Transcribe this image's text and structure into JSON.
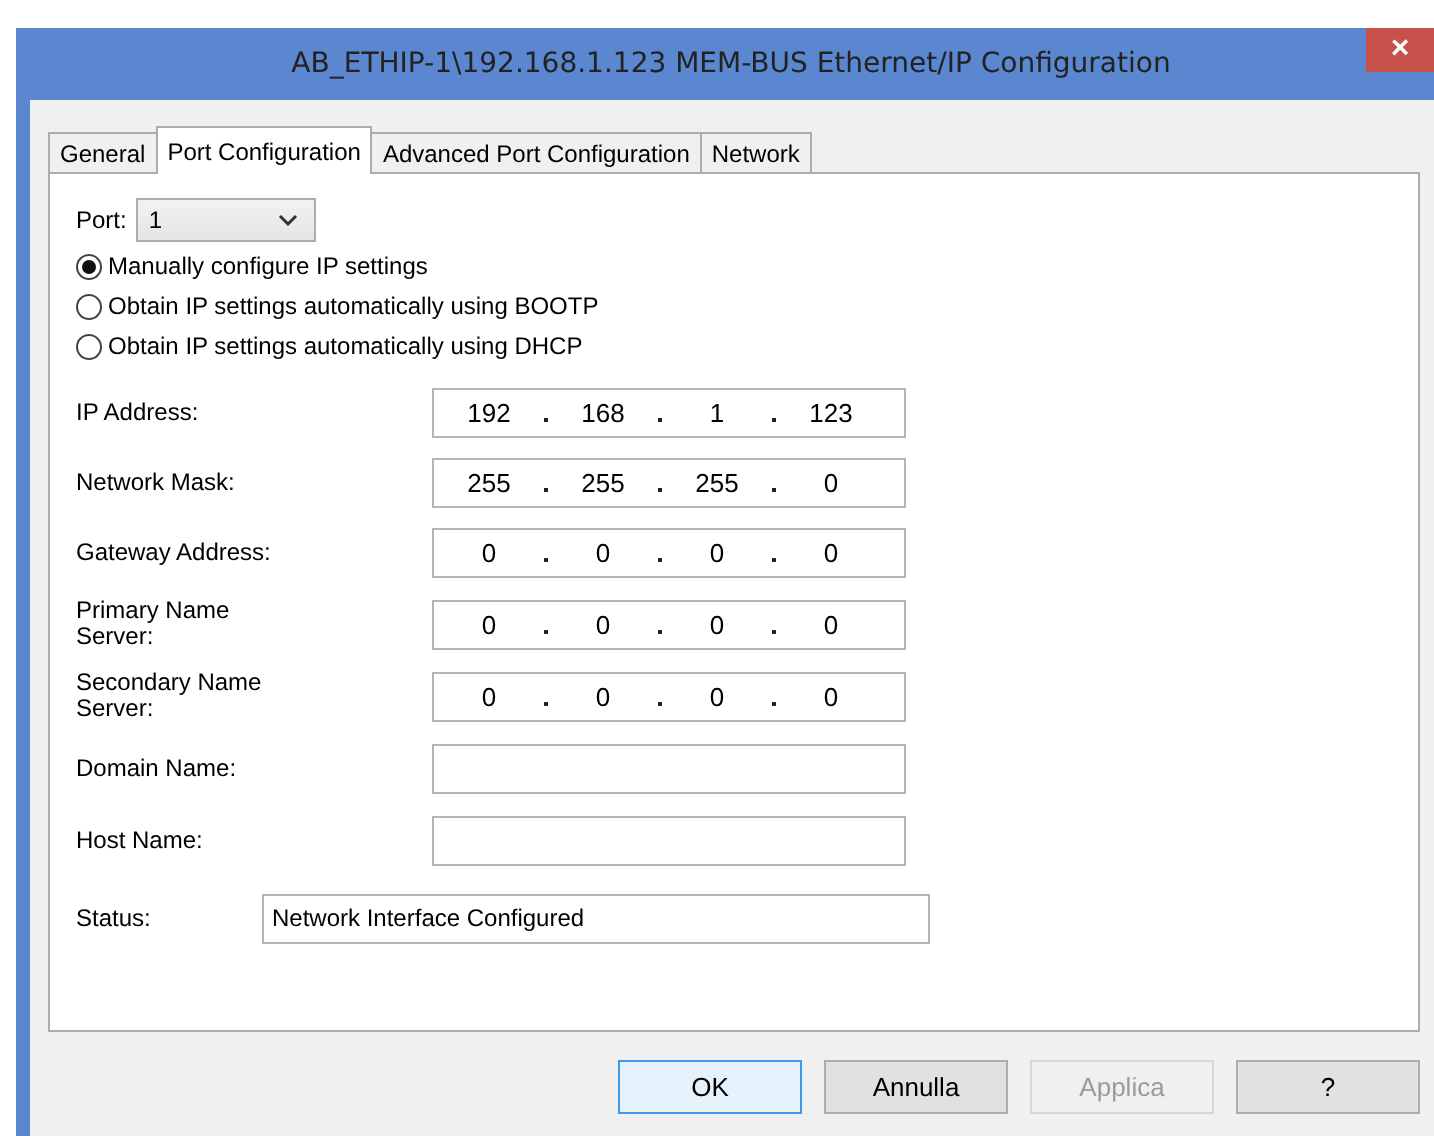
{
  "window": {
    "title": "AB_ETHIP-1\\192.168.1.123 MEM-BUS Ethernet/IP Configuration",
    "close": "×"
  },
  "tabs": [
    {
      "label": "General",
      "selected": false
    },
    {
      "label": "Port Configuration",
      "selected": true
    },
    {
      "label": "Advanced Port Configuration",
      "selected": false
    },
    {
      "label": "Network",
      "selected": false
    }
  ],
  "port": {
    "label": "Port:",
    "value": "1"
  },
  "ip_mode": [
    {
      "label": "Manually configure IP settings",
      "selected": true
    },
    {
      "label": "Obtain IP settings automatically using BOOTP",
      "selected": false
    },
    {
      "label": "Obtain IP settings automatically using DHCP",
      "selected": false
    }
  ],
  "fields": [
    {
      "kind": "ip",
      "label": "IP Address:",
      "octets": [
        "192",
        "168",
        "1",
        "123"
      ]
    },
    {
      "kind": "ip",
      "label": "Network Mask:",
      "octets": [
        "255",
        "255",
        "255",
        "0"
      ]
    },
    {
      "kind": "ip",
      "label": "Gateway Address:",
      "octets": [
        "0",
        "0",
        "0",
        "0"
      ]
    },
    {
      "kind": "ip",
      "label": "Primary Name Server:",
      "octets": [
        "0",
        "0",
        "0",
        "0"
      ]
    },
    {
      "kind": "ip",
      "label": "Secondary Name Server:",
      "octets": [
        "0",
        "0",
        "0",
        "0"
      ]
    },
    {
      "kind": "text",
      "label": "Domain Name:"
    },
    {
      "kind": "text",
      "label": "Host Name:"
    }
  ],
  "status": {
    "label": "Status:",
    "value": "Network Interface Configured"
  },
  "buttons": [
    {
      "label": "OK",
      "default": true,
      "disabled": false
    },
    {
      "label": "Annulla",
      "default": false,
      "disabled": false
    },
    {
      "label": "Applica",
      "default": false,
      "disabled": true
    },
    {
      "label": "?",
      "default": false,
      "disabled": false
    }
  ]
}
